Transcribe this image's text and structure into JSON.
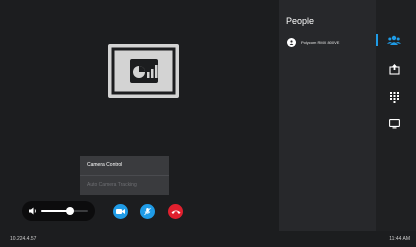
{
  "menu": {
    "items": [
      {
        "label": "Camera Control",
        "disabled": false
      },
      {
        "label": "Auto Camera Tracking",
        "disabled": true
      }
    ]
  },
  "volume": {
    "level": 0.62
  },
  "call_controls": {
    "video": "video-camera-icon",
    "mute": "microphone-muted-icon",
    "hangup": "hang-up-icon"
  },
  "status": {
    "ip": "10.224.4.57",
    "time": "11:44 AM"
  },
  "people": {
    "title": "People",
    "participants": [
      {
        "name": "Polycom RMX 800VE"
      }
    ]
  },
  "rail": {
    "items": [
      "people-icon",
      "share-content-icon",
      "dialpad-icon",
      "display-icon"
    ],
    "active": "people-icon"
  },
  "colors": {
    "accent": "#1f9be6",
    "hangup": "#e0202e",
    "background": "#1c1d1f",
    "panel": "#27282b"
  },
  "stage": {
    "content_icon": "content-share-chart-icon"
  }
}
